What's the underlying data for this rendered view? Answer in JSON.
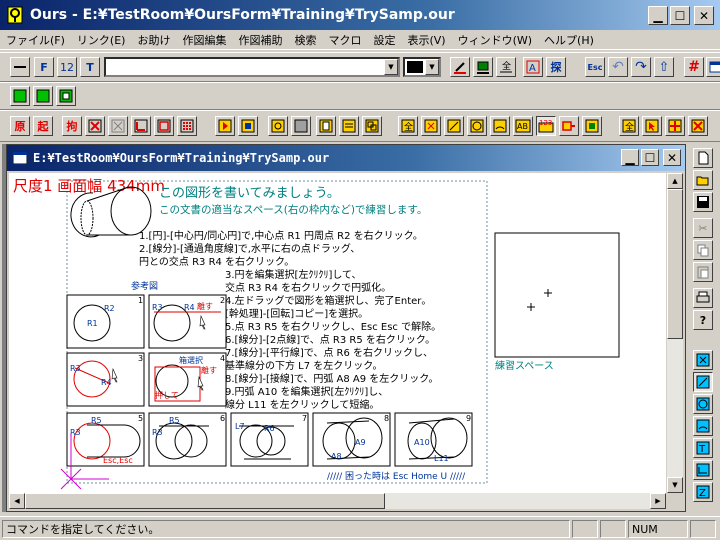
{
  "window": {
    "title": "Ours - E:¥TestRoom¥OursForm¥Training¥TrySamp.our"
  },
  "menu": [
    "ファイル(F)",
    "リンク(E)",
    "お助け",
    "作図編集",
    "作図補助",
    "検索",
    "マクロ",
    "設定",
    "表示(V)",
    "ウィンドウ(W)",
    "ヘルプ(H)"
  ],
  "toolbar1": {
    "f_label": "F",
    "size_label": "12",
    "t_label": "T",
    "esc_label": "Esc"
  },
  "toolbar3": {
    "gen": "原",
    "ki": "起",
    "kou": "拘",
    "num123": "123",
    "ab": "AB"
  },
  "child": {
    "title": "E:¥TestRoom¥OursForm¥Training¥TrySamp.our"
  },
  "drawing": {
    "header": "尺度1  画面幅 434mm",
    "title1": "この図形を書いてみましょう。",
    "title2": "この文書の適当なスペース(右の枠内など)で練習します。",
    "steps": [
      "1.[円]-[中心円/同心円]で,中心点 R1 円周点 R2 を右クリック。",
      "2.[線分]-[通過角度線]で,水平に右の点ドラッグ、",
      "  円との交点 R3 R4 を右クリック。",
      "3.円を編集選択[左ｸﾘｸﾘ]して、",
      "  交点 R3 R4 を右クリックで円弧化。",
      "4.左ドラッグで図形を箱選択し、完了Enter。",
      "  [幹処理]-[回転]コピー]を選択。",
      "5.点 R3 R5 を右クリックし、Esc Esc で解除。",
      "6.[線分]-[2点線]で、点 R3 R5 を右クリック。",
      "7.[線分]-[平行線]で、点 R6 を右クリックし、",
      "  基準線分の下方 L7 を左クリック。",
      "8.[線分]-[接線]で、円弧 A8 A9 を左クリック。",
      "9.円弧 A10 を編集選択[左ｸﾘｸﾘ]し、",
      "  線分 L11 を左クリックして短縮。"
    ],
    "ref_label": "参考図",
    "practice_label": "練習スペース",
    "footer": "///// 困った時は Esc Home U /////",
    "panel_labels": {
      "p1": [
        "1",
        "R1",
        "R2"
      ],
      "p2": [
        "2",
        "R3",
        "R4",
        "離す"
      ],
      "p3": [
        "3",
        "R3",
        "R4"
      ],
      "p4": [
        "4",
        "箱選択",
        "離す",
        "押して"
      ],
      "p5": [
        "5",
        "R5",
        "R3",
        "Esc,Esc"
      ],
      "p6": [
        "6",
        "R5",
        "R3"
      ],
      "p7": [
        "7",
        "L7",
        "R6"
      ],
      "p8": [
        "8",
        "A8",
        "A9"
      ],
      "p9": [
        "9",
        "A10",
        "L11"
      ]
    }
  },
  "status": {
    "message": "コマンドを指定してください。",
    "num": "NUM"
  },
  "colors": {
    "title_start": "#0a246a",
    "title_end": "#a6caf0",
    "red": "#e00000",
    "teal": "#008080",
    "face": "#d4d0c8"
  }
}
